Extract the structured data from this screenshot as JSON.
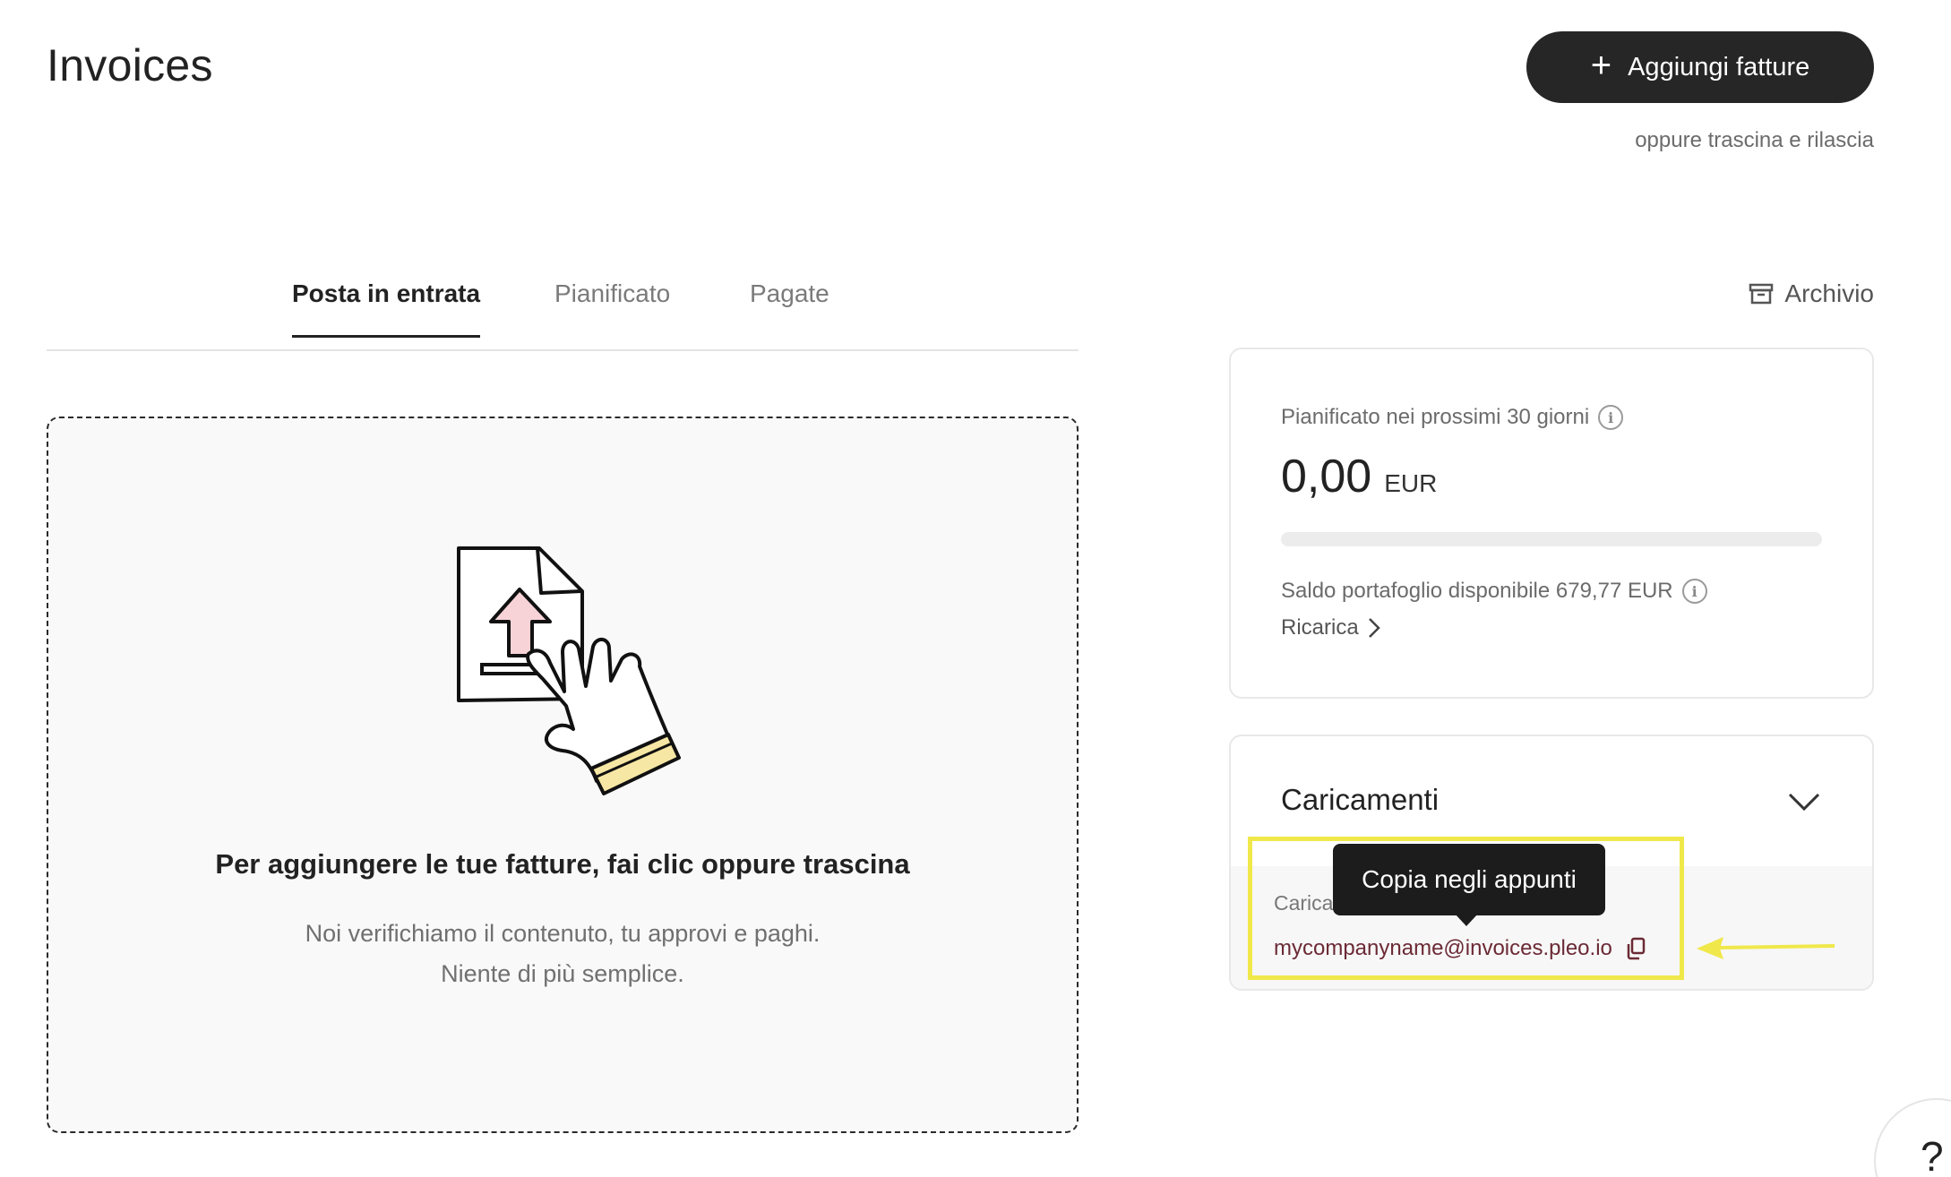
{
  "page": {
    "title": "Invoices"
  },
  "header": {
    "add_button_label": "Aggiungi fatture",
    "drag_hint": "oppure trascina e rilascia"
  },
  "tabs": [
    {
      "label": "Posta in entrata",
      "active": true
    },
    {
      "label": "Pianificato",
      "active": false
    },
    {
      "label": "Pagate",
      "active": false
    }
  ],
  "archive": {
    "label": "Archivio",
    "icon": "archive-box-icon"
  },
  "dropzone": {
    "title": "Per aggiungere le tue fatture, fai clic oppure trascina",
    "subtitle_line1": "Noi verifichiamo il contenuto, tu approvi e paghi.",
    "subtitle_line2": "Niente di più semplice.",
    "illustration": "hand-tapping-upload-document"
  },
  "scheduled": {
    "label": "Pianificato nei prossimi 30 giorni",
    "amount": "0,00",
    "currency": "EUR",
    "progress_fraction": 0,
    "wallet_text": "Saldo portafoglio disponibile 679,77 EUR",
    "topup_label": "Ricarica"
  },
  "uploads": {
    "title": "Caricamenti",
    "label_partial": "Carica",
    "email": "mycompanyname@invoices.pleo.io"
  },
  "tooltip": {
    "text": "Copia negli appunti"
  },
  "help": {
    "label": "?"
  },
  "colors": {
    "primary_button": "#262626",
    "email_link": "#6b2a35",
    "highlight": "#f0e84a"
  }
}
